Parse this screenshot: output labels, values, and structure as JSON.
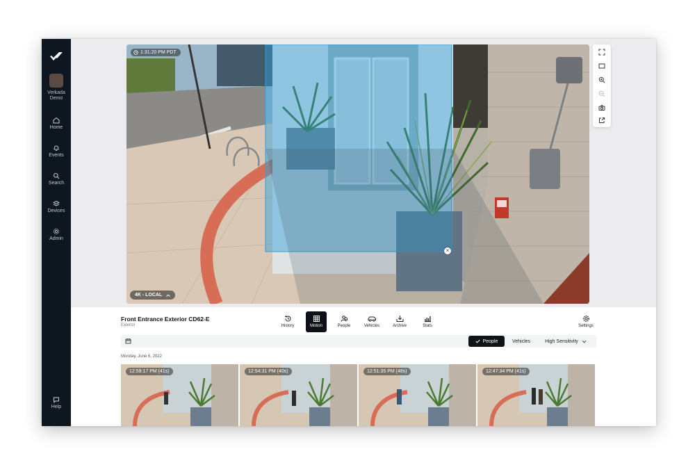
{
  "sidebar": {
    "org_name": "Verkada Demo",
    "items": [
      {
        "label": "Home",
        "icon": "home-icon"
      },
      {
        "label": "Events",
        "icon": "bell-icon"
      },
      {
        "label": "Search",
        "icon": "search-icon"
      },
      {
        "label": "Devices",
        "icon": "devices-icon"
      },
      {
        "label": "Admin",
        "icon": "admin-icon"
      }
    ],
    "help_label": "Help"
  },
  "video": {
    "timestamp": "1:31:20 PM PDT",
    "quality_label": "4K - LOCAL",
    "zone_color": "#2f9fdc"
  },
  "camera": {
    "name": "Front Entrance Exterior CD62-E",
    "location": "Exterior"
  },
  "mode_tabs": [
    {
      "label": "History",
      "icon": "history-icon"
    },
    {
      "label": "Motion",
      "icon": "motion-grid-icon",
      "active": true
    },
    {
      "label": "People",
      "icon": "people-icon"
    },
    {
      "label": "Vehicles",
      "icon": "vehicle-icon"
    },
    {
      "label": "Archive",
      "icon": "archive-icon"
    },
    {
      "label": "Stats",
      "icon": "stats-icon"
    }
  ],
  "settings_label": "Settings",
  "filters": {
    "people_label": "People",
    "people_selected": true,
    "vehicles_label": "Vehicles",
    "sensitivity_label": "High Sensitivity"
  },
  "results": {
    "date": "Monday, June 6, 2022",
    "clips": [
      {
        "time": "12:59:17 PM (41s)"
      },
      {
        "time": "12:54:31 PM (40s)"
      },
      {
        "time": "12:51:35 PM (48s)"
      },
      {
        "time": "12:47:34 PM (41s)"
      }
    ]
  },
  "colors": {
    "sidebar_bg": "#0e1620",
    "active_tab_bg": "#0e1116",
    "accent": "#0e1116"
  }
}
